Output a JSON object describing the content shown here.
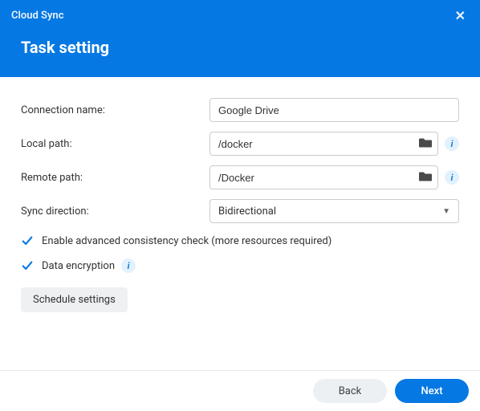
{
  "window": {
    "title": "Cloud Sync"
  },
  "page": {
    "heading": "Task setting"
  },
  "form": {
    "conn_name_label": "Connection name:",
    "conn_name_value": "Google Drive",
    "local_path_label": "Local path:",
    "local_path_value": "/docker",
    "remote_path_label": "Remote path:",
    "remote_path_value": "/Docker",
    "sync_dir_label": "Sync direction:",
    "sync_dir_value": "Bidirectional",
    "consistency_label": "Enable advanced consistency check (more resources required)",
    "consistency_checked": true,
    "encryption_label": "Data encryption",
    "encryption_checked": true,
    "schedule_label": "Schedule settings"
  },
  "footer": {
    "back": "Back",
    "next": "Next"
  }
}
